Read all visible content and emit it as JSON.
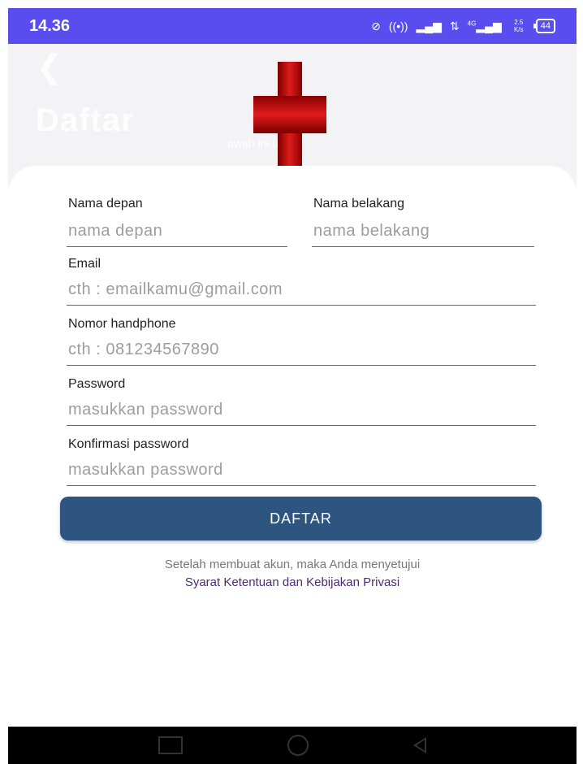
{
  "status_bar": {
    "time": "14.36",
    "icons": [
      "dnd-icon",
      "hotspot-icon",
      "signal-icon",
      "data-icon",
      "4g-signal-icon",
      "speed-icon",
      "battery-icon"
    ],
    "battery": "44",
    "speed": "2.5 K/s",
    "network": "4G",
    "bg_color": "#5a4df0"
  },
  "header": {
    "title": "Daftar",
    "subtitle": "awah ini unt"
  },
  "form": {
    "first_name_label": "Nama depan",
    "first_name_placeholder": "nama depan",
    "last_name_label": "Nama belakang",
    "last_name_placeholder": "nama belakang",
    "email_label": "Email",
    "email_placeholder": "cth : emailkamu@gmail.com",
    "phone_label": "Nomor handphone",
    "phone_placeholder": "cth : 081234567890",
    "password_label": "Password",
    "password_placeholder": "masukkan password",
    "confirm_label": "Konfirmasi password",
    "confirm_placeholder": "masukkan password",
    "submit_label": "DAFTAR",
    "button_color": "#2e5580"
  },
  "terms": {
    "text": "Setelah membuat akun, maka Anda menyetujui",
    "link": "Syarat Ketentuan dan Kebijakan Privasi",
    "link_color": "#4a2b75"
  },
  "nav_bar": {
    "icons": [
      "recent-apps-icon",
      "home-icon",
      "back-icon"
    ]
  }
}
